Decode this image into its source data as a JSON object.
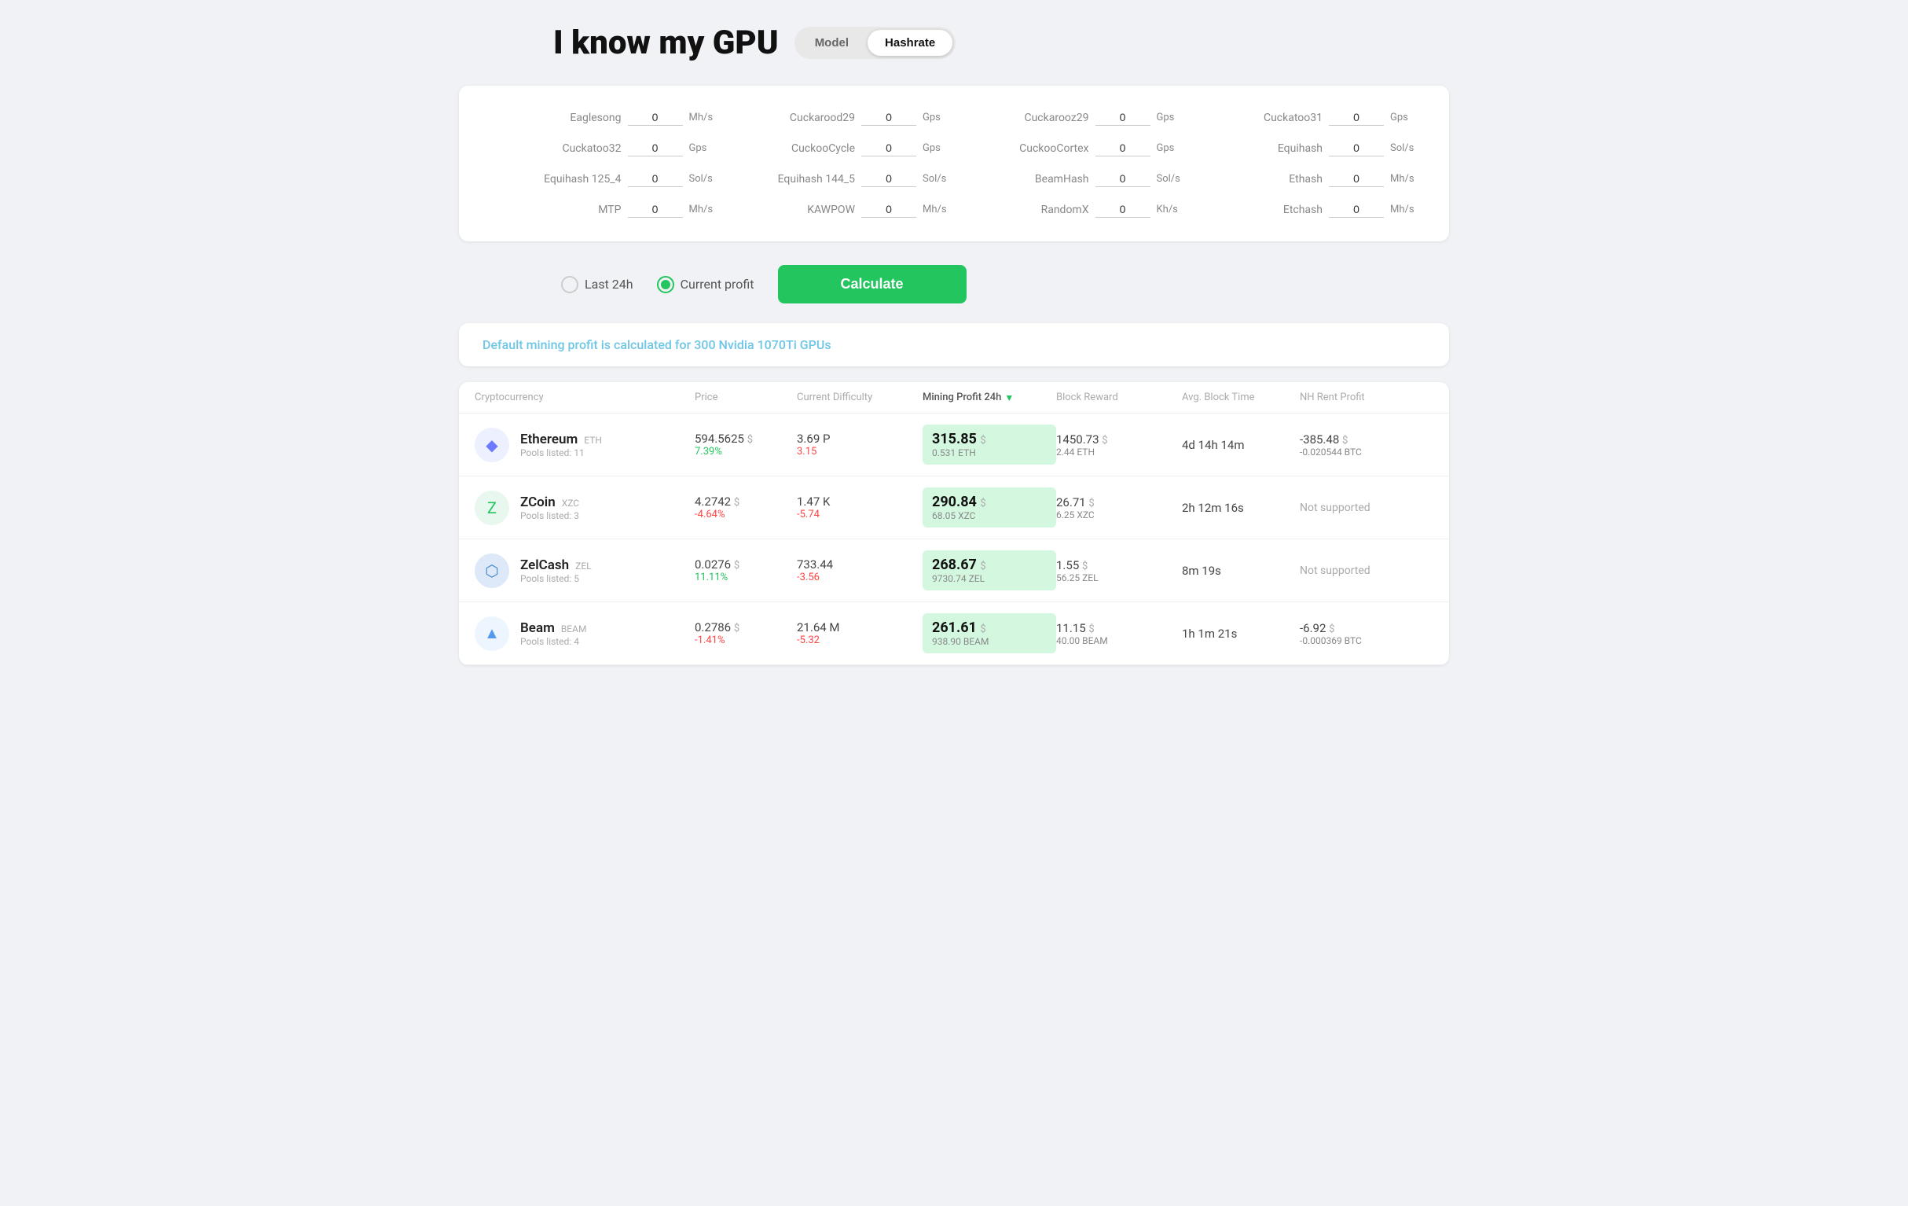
{
  "header": {
    "title": "I know my GPU",
    "toggle": {
      "model_label": "Model",
      "hashrate_label": "Hashrate",
      "active": "hashrate"
    }
  },
  "hashrate_fields": [
    {
      "label": "Eaglesong",
      "value": "0",
      "unit": "Mh/s"
    },
    {
      "label": "Cuckarood29",
      "value": "0",
      "unit": "Gps"
    },
    {
      "label": "Cuckarooz29",
      "value": "0",
      "unit": "Gps"
    },
    {
      "label": "Cuckatoo31",
      "value": "0",
      "unit": "Gps"
    },
    {
      "label": "Cuckatoo32",
      "value": "0",
      "unit": "Gps"
    },
    {
      "label": "CuckooCycle",
      "value": "0",
      "unit": "Gps"
    },
    {
      "label": "CuckooCortex",
      "value": "0",
      "unit": "Gps"
    },
    {
      "label": "Equihash",
      "value": "0",
      "unit": "Sol/s"
    },
    {
      "label": "Equihash 125_4",
      "value": "0",
      "unit": "Sol/s"
    },
    {
      "label": "Equihash 144_5",
      "value": "0",
      "unit": "Sol/s"
    },
    {
      "label": "BeamHash",
      "value": "0",
      "unit": "Sol/s"
    },
    {
      "label": "Ethash",
      "value": "0",
      "unit": "Mh/s"
    },
    {
      "label": "MTP",
      "value": "0",
      "unit": "Mh/s"
    },
    {
      "label": "KAWPOW",
      "value": "0",
      "unit": "Mh/s"
    },
    {
      "label": "RandomX",
      "value": "0",
      "unit": "Kh/s"
    },
    {
      "label": "Etchash",
      "value": "0",
      "unit": "Mh/s"
    }
  ],
  "controls": {
    "last24h_label": "Last 24h",
    "current_profit_label": "Current profit",
    "active_radio": "current_profit",
    "calculate_label": "Calculate"
  },
  "info_banner": {
    "text": "Default mining profit is calculated for 300 Nvidia 1070Ti GPUs"
  },
  "table": {
    "headers": {
      "cryptocurrency": "Cryptocurrency",
      "price": "Price",
      "current_difficulty": "Current Difficulty",
      "mining_profit_24h": "Mining Profit 24h",
      "block_reward": "Block Reward",
      "avg_block_time": "Avg. Block Time",
      "nh_rent_profit": "NH Rent Profit"
    },
    "rows": [
      {
        "name": "Ethereum",
        "ticker": "ETH",
        "icon_type": "eth",
        "icon_symbol": "◆",
        "pools": "11",
        "price": "594.5625",
        "price_currency": "$",
        "price_change": "7.39%",
        "price_change_type": "green",
        "difficulty": "3.69 P",
        "difficulty_change": "3.15",
        "difficulty_change_type": "red",
        "profit": "315.85",
        "profit_currency": "$",
        "profit_sub": "0.531 ETH",
        "reward": "1450.73",
        "reward_currency": "$",
        "reward_sub": "2.44 ETH",
        "block_time": "4d 14h 14m",
        "nh_rent": "-385.48",
        "nh_rent_currency": "$",
        "nh_rent_sub": "-0.020544 BTC",
        "nh_supported": true
      },
      {
        "name": "ZCoin",
        "ticker": "XZC",
        "icon_type": "zcoin",
        "icon_symbol": "Z",
        "pools": "3",
        "price": "4.2742",
        "price_currency": "$",
        "price_change": "-4.64%",
        "price_change_type": "red",
        "difficulty": "1.47 K",
        "difficulty_change": "-5.74",
        "difficulty_change_type": "red",
        "profit": "290.84",
        "profit_currency": "$",
        "profit_sub": "68.05 XZC",
        "reward": "26.71",
        "reward_currency": "$",
        "reward_sub": "6.25 XZC",
        "block_time": "2h 12m 16s",
        "nh_rent": "Not supported",
        "nh_supported": false
      },
      {
        "name": "ZelCash",
        "ticker": "ZEL",
        "icon_type": "zelcash",
        "icon_symbol": "⬡",
        "pools": "5",
        "price": "0.0276",
        "price_currency": "$",
        "price_change": "11.11%",
        "price_change_type": "green",
        "difficulty": "733.44",
        "difficulty_change": "-3.56",
        "difficulty_change_type": "red",
        "profit": "268.67",
        "profit_currency": "$",
        "profit_sub": "9730.74 ZEL",
        "reward": "1.55",
        "reward_currency": "$",
        "reward_sub": "56.25 ZEL",
        "block_time": "8m 19s",
        "nh_rent": "Not supported",
        "nh_supported": false
      },
      {
        "name": "Beam",
        "ticker": "BEAM",
        "icon_type": "beam",
        "icon_symbol": "▲",
        "pools": "4",
        "price": "0.2786",
        "price_currency": "$",
        "price_change": "-1.41%",
        "price_change_type": "red",
        "difficulty": "21.64 M",
        "difficulty_change": "-5.32",
        "difficulty_change_type": "red",
        "profit": "261.61",
        "profit_currency": "$",
        "profit_sub": "938.90 BEAM",
        "reward": "11.15",
        "reward_currency": "$",
        "reward_sub": "40.00 BEAM",
        "block_time": "1h 1m 21s",
        "nh_rent": "-6.92",
        "nh_rent_currency": "$",
        "nh_rent_sub": "-0.000369 BTC",
        "nh_supported": true
      }
    ]
  }
}
